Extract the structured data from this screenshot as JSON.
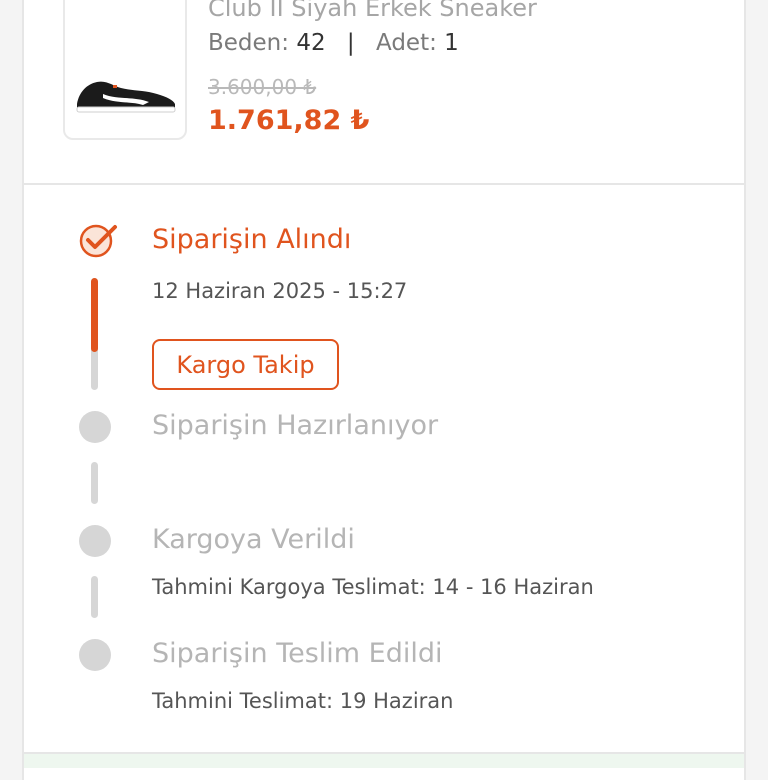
{
  "product": {
    "name": "Club II Siyah Erkek Sneaker",
    "size_label": "Beden:",
    "size_value": "42",
    "separator": "|",
    "qty_label": "Adet:",
    "qty_value": "1",
    "old_price": "3.600,00 ₺",
    "new_price": "1.761,82 ₺"
  },
  "tracking": {
    "steps": [
      {
        "title": "Siparişin Alındı",
        "subtitle": "12 Haziran 2025 - 15:27",
        "status": "done"
      },
      {
        "title": "Siparişin Hazırlanıyor",
        "subtitle": "",
        "status": "pending"
      },
      {
        "title": "Kargoya Verildi",
        "subtitle": "Tahmini Kargoya Teslimat: 14 - 16 Haziran",
        "status": "pending"
      },
      {
        "title": "Siparişin Teslim Edildi",
        "subtitle": "Tahmini Teslimat: 19 Haziran",
        "status": "pending"
      }
    ],
    "track_button": "Kargo Takip",
    "progress_fraction": 0.75
  },
  "colors": {
    "accent": "#e0541e",
    "inactive": "#d6d6d6"
  },
  "icons": {
    "step_done": "check-icon",
    "step_pending": "dot-icon"
  }
}
